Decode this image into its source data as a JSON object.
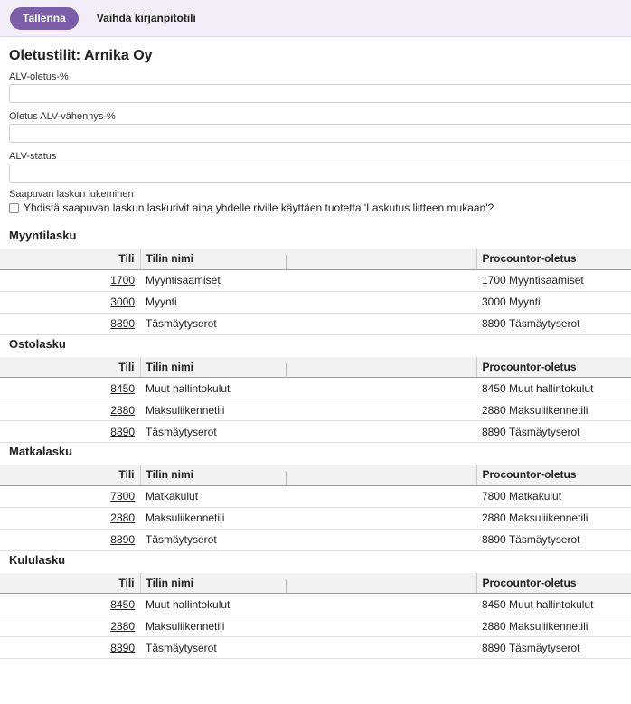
{
  "toolbar": {
    "save_label": "Tallenna",
    "switch_label": "Vaihda kirjanpitotili"
  },
  "page": {
    "title": "Oletustilit: Arnika Oy"
  },
  "fields": [
    {
      "label": "ALV-oletus-%",
      "value": ""
    },
    {
      "label": "Oletus ALV-vähennys-%",
      "value": ""
    },
    {
      "label": "ALV-status",
      "value": ""
    }
  ],
  "incoming": {
    "label": "Saapuvan laskun lukeminen",
    "checkbox_label": "Yhdistä saapuvan laskun laskurivit aina yhdelle riville käyttäen tuotetta 'Laskutus liitteen mukaan'?",
    "checked": false
  },
  "columns": {
    "account": "Tili",
    "name": "Tilin nimi",
    "default": "Procountor-oletus"
  },
  "sections": [
    {
      "title": "Myyntilasku",
      "rows": [
        {
          "account": "1700",
          "name": "Myyntisaamiset",
          "default": "1700 Myyntisaamiset"
        },
        {
          "account": "3000",
          "name": "Myynti",
          "default": "3000 Myynti"
        },
        {
          "account": "8890",
          "name": "Täsmäytyserot",
          "default": "8890 Täsmäytyserot"
        }
      ]
    },
    {
      "title": "Ostolasku",
      "rows": [
        {
          "account": "8450",
          "name": "Muut hallintokulut",
          "default": "8450 Muut hallintokulut"
        },
        {
          "account": "2880",
          "name": "Maksuliikennetili",
          "default": "2880 Maksuliikennetili"
        },
        {
          "account": "8890",
          "name": "Täsmäytyserot",
          "default": "8890 Täsmäytyserot"
        }
      ]
    },
    {
      "title": "Matkalasku",
      "rows": [
        {
          "account": "7800",
          "name": "Matkakulut",
          "default": "7800 Matkakulut"
        },
        {
          "account": "2880",
          "name": "Maksuliikennetili",
          "default": "2880 Maksuliikennetili"
        },
        {
          "account": "8890",
          "name": "Täsmäytyserot",
          "default": "8890 Täsmäytyserot"
        }
      ]
    },
    {
      "title": "Kululasku",
      "rows": [
        {
          "account": "8450",
          "name": "Muut hallintokulut",
          "default": "8450 Muut hallintokulut"
        },
        {
          "account": "2880",
          "name": "Maksuliikennetili",
          "default": "2880 Maksuliikennetili"
        },
        {
          "account": "8890",
          "name": "Täsmäytyserot",
          "default": "8890 Täsmäytyserot"
        }
      ]
    }
  ]
}
